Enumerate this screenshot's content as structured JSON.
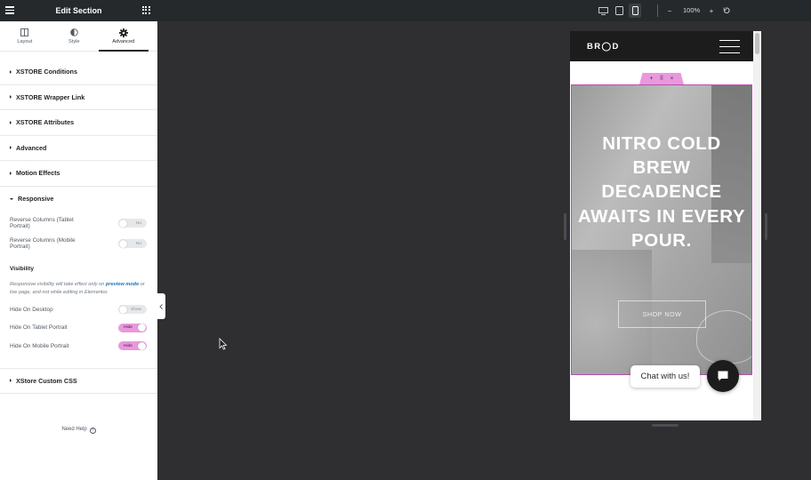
{
  "panel": {
    "title": "Edit Section",
    "tabs": [
      {
        "label": "Layout",
        "icon": "layout-icon"
      },
      {
        "label": "Style",
        "icon": "style-icon"
      },
      {
        "label": "Advanced",
        "icon": "gear-icon"
      }
    ],
    "active_tab": "Advanced",
    "sections": [
      {
        "label": "XSTORE Conditions"
      },
      {
        "label": "XSTORE Wrapper Link"
      },
      {
        "label": "XSTORE Attributes"
      },
      {
        "label": "Advanced"
      },
      {
        "label": "Motion Effects"
      },
      {
        "label": "Responsive"
      },
      {
        "label": "XStore Custom CSS"
      }
    ],
    "responsive": {
      "reverse_tablet": {
        "label": "Reverse Columns (Tablet Portrait)",
        "state": "No"
      },
      "reverse_mobile": {
        "label": "Reverse Columns (Mobile Portrait)",
        "state": "No"
      },
      "visibility_heading": "Visibility",
      "note": {
        "before": "Responsive visibility will take effect only on ",
        "link": "preview mode",
        "after": " or live page, and not while editing in Elementor."
      },
      "hide_desktop": {
        "label": "Hide On Desktop",
        "state": "Show"
      },
      "hide_tablet": {
        "label": "Hide On Tablet Portrait",
        "state": "Hide"
      },
      "hide_mobile": {
        "label": "Hide On Mobile Portrait",
        "state": "Hide"
      }
    },
    "need_help": "Need Help"
  },
  "topbar": {
    "devices": [
      "desktop-icon",
      "tablet-icon",
      "mobile-icon"
    ],
    "active_device": "mobile",
    "zoom": "100%",
    "zoom_out": "−",
    "zoom_in": "+"
  },
  "preview": {
    "logo": "BR◯D",
    "hero_title": "NITRO COLD BREW DECADENCE AWAITS IN EVERY POUR.",
    "cta": "SHOP NOW",
    "chat_label": "Chat with us!",
    "section_tools": [
      "+",
      "⠿",
      "×"
    ]
  },
  "colors": {
    "accent": "#e998dd",
    "panel_header": "#26292c",
    "canvas": "#2f2f31",
    "link": "#2271b1",
    "hero_border": "#b54fa8"
  }
}
